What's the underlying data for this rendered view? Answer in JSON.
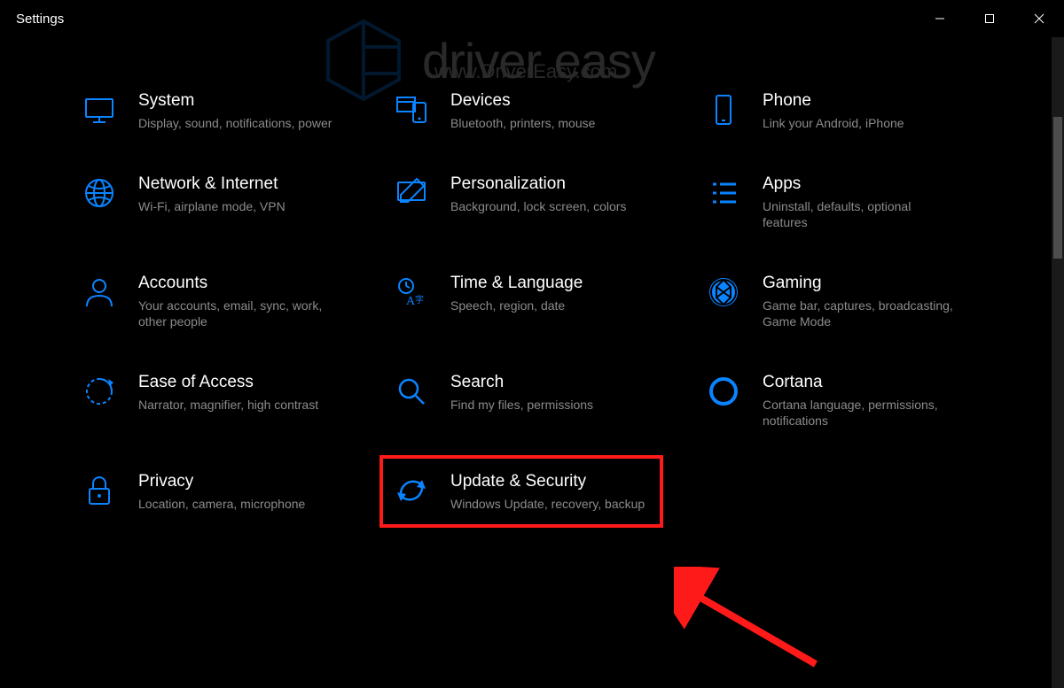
{
  "window": {
    "title": "Settings"
  },
  "watermark": {
    "brand": "driver easy",
    "sub": "www.DriverEasy.com"
  },
  "categories": [
    {
      "id": "system",
      "title": "System",
      "sub": "Display, sound, notifications, power"
    },
    {
      "id": "devices",
      "title": "Devices",
      "sub": "Bluetooth, printers, mouse"
    },
    {
      "id": "phone",
      "title": "Phone",
      "sub": "Link your Android, iPhone"
    },
    {
      "id": "network",
      "title": "Network & Internet",
      "sub": "Wi-Fi, airplane mode, VPN"
    },
    {
      "id": "personalization",
      "title": "Personalization",
      "sub": "Background, lock screen, colors"
    },
    {
      "id": "apps",
      "title": "Apps",
      "sub": "Uninstall, defaults, optional features"
    },
    {
      "id": "accounts",
      "title": "Accounts",
      "sub": "Your accounts, email, sync, work, other people"
    },
    {
      "id": "time",
      "title": "Time & Language",
      "sub": "Speech, region, date"
    },
    {
      "id": "gaming",
      "title": "Gaming",
      "sub": "Game bar, captures, broadcasting, Game Mode"
    },
    {
      "id": "ease",
      "title": "Ease of Access",
      "sub": "Narrator, magnifier, high contrast"
    },
    {
      "id": "search",
      "title": "Search",
      "sub": "Find my files, permissions"
    },
    {
      "id": "cortana",
      "title": "Cortana",
      "sub": "Cortana language, permissions, notifications"
    },
    {
      "id": "privacy",
      "title": "Privacy",
      "sub": "Location, camera, microphone"
    },
    {
      "id": "update",
      "title": "Update & Security",
      "sub": "Windows Update, recovery, backup"
    }
  ],
  "highlighted": "update",
  "accent": "#0a84ff"
}
